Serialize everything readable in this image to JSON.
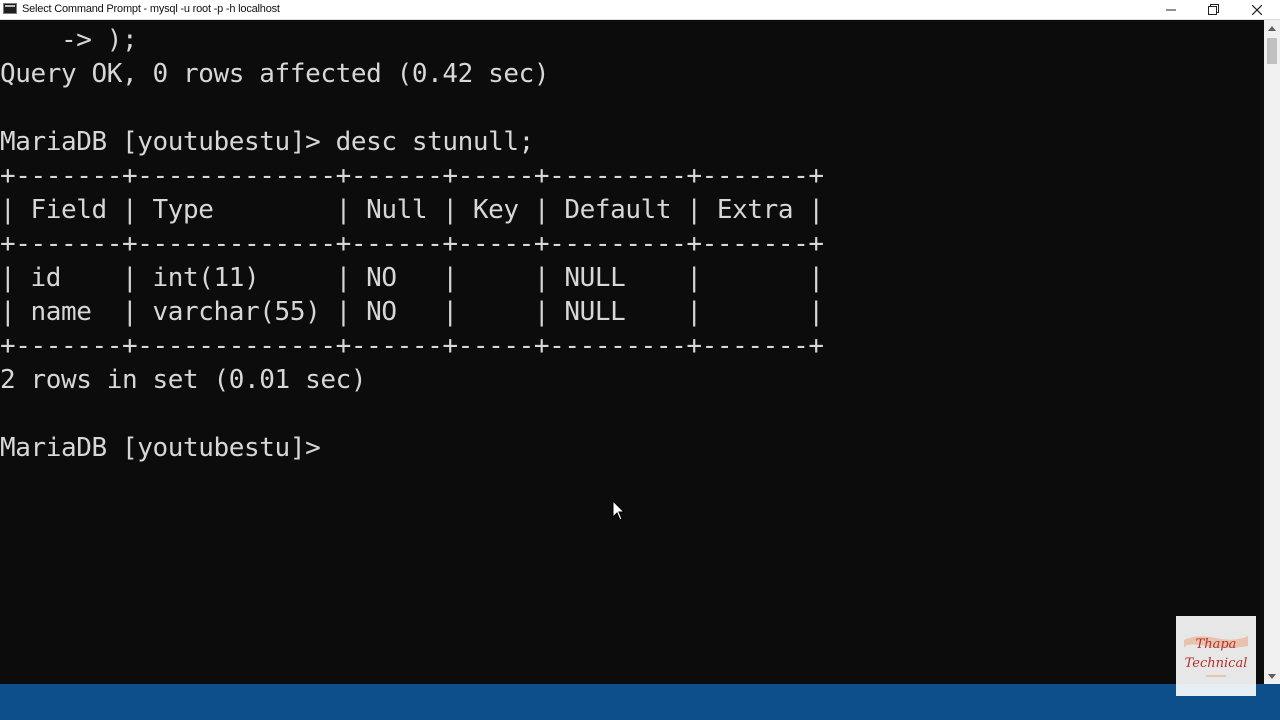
{
  "window": {
    "title": "Select Command Prompt - mysql  -u root -p -h localhost"
  },
  "titlebar_buttons": {
    "minimize_icon": "minimize-icon",
    "maximize_icon": "restore-icon",
    "close_icon": "close-icon"
  },
  "console": {
    "lines": [
      "    -> );",
      "Query OK, 0 rows affected (0.42 sec)",
      "",
      "MariaDB [youtubestu]> desc stunull;",
      "+-------+-------------+------+-----+---------+-------+",
      "| Field | Type        | Null | Key | Default | Extra |",
      "+-------+-------------+------+-----+---------+-------+",
      "| id    | int(11)     | NO   |     | NULL    |       |",
      "| name  | varchar(55) | NO   |     | NULL    |       |",
      "+-------+-------------+------+-----+---------+-------+",
      "2 rows in set (0.01 sec)",
      "",
      "MariaDB [youtubestu]> "
    ]
  },
  "watermark": {
    "line1": "Thapa",
    "line2": "Technical"
  },
  "colors": {
    "console_bg": "#0c0c0c",
    "console_text": "#d7d7d7",
    "taskbar": "#0d4f8b"
  }
}
